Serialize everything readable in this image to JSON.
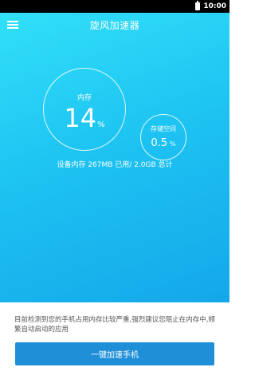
{
  "status_bar": {
    "time": "10:00",
    "battery_icon": "battery-icon"
  },
  "app_bar": {
    "title": "旋风加速器",
    "menu_icon": "menu-icon"
  },
  "memory": {
    "label": "内存",
    "value": "14",
    "unit": "%"
  },
  "storage": {
    "label": "存储空间",
    "value": "0.5",
    "unit": "%"
  },
  "device_memory_text": "设备内存 267MB 已用/ 2.0GB 总计",
  "warning_text": "目前检测到您的手机占用内存比较严重,强烈建议您阻止在内存中,频繁自动启动的应用",
  "boost_button_label": "一键加速手机",
  "colors": {
    "gradient_start": "#32e0f8",
    "gradient_end": "#14a7ea",
    "button": "#1f8fd8"
  }
}
